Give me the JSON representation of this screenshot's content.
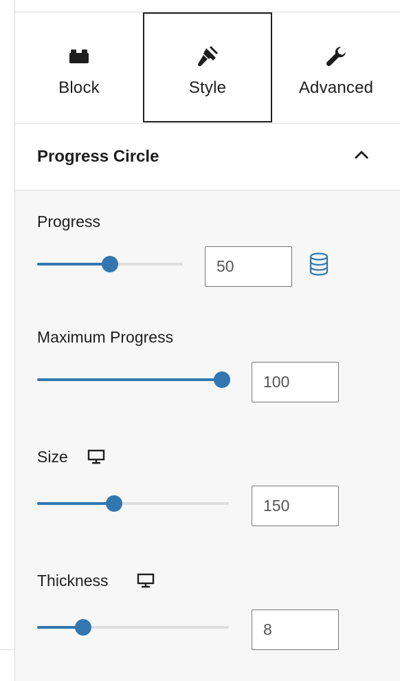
{
  "tabs": [
    {
      "label": "Block",
      "icon": "block-icon"
    },
    {
      "label": "Style",
      "icon": "brush-icon",
      "active": true
    },
    {
      "label": "Advanced",
      "icon": "wrench-icon"
    }
  ],
  "panel": {
    "title": "Progress Circle",
    "expanded": true
  },
  "controls": {
    "progress": {
      "label": "Progress",
      "value": "50",
      "slider_fraction": 0.5,
      "dynamic_icon": "database-icon"
    },
    "max_progress": {
      "label": "Maximum Progress",
      "value": "100",
      "slider_fraction": 1.0
    },
    "size": {
      "label": "Size",
      "value": "150",
      "slider_fraction": 0.4,
      "device_icon": "desktop-icon"
    },
    "thickness": {
      "label": "Thickness",
      "value": "8",
      "slider_fraction": 0.24,
      "device_icon": "desktop-icon"
    }
  },
  "colors": {
    "accent": "#3377b0",
    "rail": "#dddddd",
    "text": "#1e1e1e"
  }
}
